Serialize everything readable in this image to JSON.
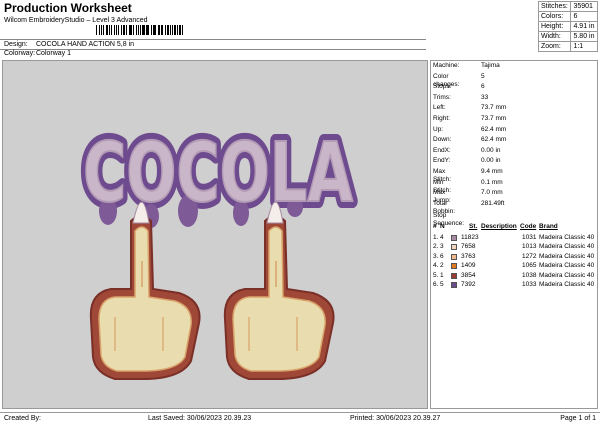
{
  "header": {
    "title": "Production Worksheet",
    "subtitle": "Wilcom EmbroideryStudio – Level 3 Advanced",
    "design_label": "Design:",
    "design_value": "COCOLA HAND ACTION 5,8 in",
    "colorway_label": "Colorway:",
    "colorway_value": "Colorway 1"
  },
  "stats": [
    {
      "label": "Stitches:",
      "value": "35901"
    },
    {
      "label": "Colors:",
      "value": "6"
    },
    {
      "label": "Height:",
      "value": "4.91 in"
    },
    {
      "label": "Width:",
      "value": "5.80 in"
    },
    {
      "label": "Zoom:",
      "value": "1:1"
    }
  ],
  "design": {
    "text": "COCOLA"
  },
  "details": [
    {
      "label": "Machine:",
      "value": "Tajima"
    },
    {
      "label": "Color changes:",
      "value": "5"
    },
    {
      "label": "Stops:",
      "value": "6"
    },
    {
      "label": "Trims:",
      "value": "33"
    },
    {
      "label": "Left:",
      "value": "73.7 mm"
    },
    {
      "label": "Right:",
      "value": "73.7 mm"
    },
    {
      "label": "Up:",
      "value": "62.4 mm"
    },
    {
      "label": "Down:",
      "value": "62.4 mm"
    },
    {
      "label": "EndX:",
      "value": "0.00 in"
    },
    {
      "label": "EndY:",
      "value": "0.00 in"
    },
    {
      "label": "Max Stitch:",
      "value": "9.4 mm"
    },
    {
      "label": "Min Stitch:",
      "value": "0.1 mm"
    },
    {
      "label": "Max Jump:",
      "value": "7.0 mm"
    },
    {
      "label": "Total Bobbin:",
      "value": "281.49ft"
    }
  ],
  "sequence": {
    "title": "Stop Sequence:",
    "headers": [
      "#",
      "N",
      "St.",
      "Description",
      "Code",
      "Brand"
    ],
    "rows": [
      {
        "idx": "1.",
        "n": "4",
        "color": "#a98ba6",
        "st": "11823",
        "desc": "",
        "code": "1031",
        "brand": "Madeira Classic 40"
      },
      {
        "idx": "2.",
        "n": "3",
        "color": "#f0d3bd",
        "st": "7658",
        "desc": "",
        "code": "1013",
        "brand": "Madeira Classic 40"
      },
      {
        "idx": "3.",
        "n": "6",
        "color": "#f2b98c",
        "st": "3763",
        "desc": "",
        "code": "1272",
        "brand": "Madeira Classic 40"
      },
      {
        "idx": "4.",
        "n": "2",
        "color": "#e07a21",
        "st": "1409",
        "desc": "",
        "code": "1065",
        "brand": "Madeira Classic 40"
      },
      {
        "idx": "5.",
        "n": "1",
        "color": "#9b3b34",
        "st": "3854",
        "desc": "",
        "code": "1038",
        "brand": "Madeira Classic 40"
      },
      {
        "idx": "6.",
        "n": "5",
        "color": "#6e4a8e",
        "st": "7392",
        "desc": "",
        "code": "1033",
        "brand": "Madeira Classic 40"
      }
    ]
  },
  "footer": {
    "created_by": "Created By:",
    "last_saved": "Last Saved: 30/06/2023 20.39.23",
    "printed": "Printed: 30/06/2023 20.39.27",
    "page": "Page 1 of 1"
  }
}
